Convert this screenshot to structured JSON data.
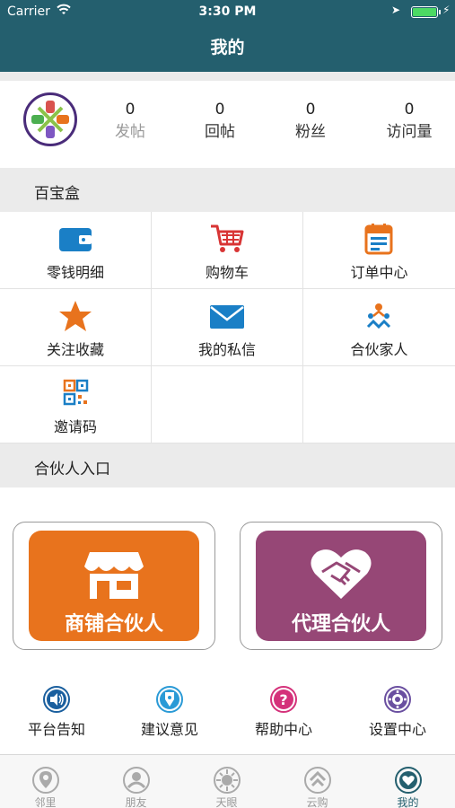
{
  "status_bar": {
    "carrier": "Carrier",
    "time": "3:30 PM"
  },
  "header": {
    "title": "我的"
  },
  "profile": {
    "stats": [
      {
        "value": "0",
        "label": "发帖"
      },
      {
        "value": "0",
        "label": "回帖"
      },
      {
        "value": "0",
        "label": "粉丝"
      },
      {
        "value": "0",
        "label": "访问量"
      }
    ]
  },
  "toolbox": {
    "title": "百宝盒",
    "items": [
      {
        "label": "零钱明细",
        "icon": "wallet-icon"
      },
      {
        "label": "购物车",
        "icon": "cart-icon"
      },
      {
        "label": "订单中心",
        "icon": "calendar-icon"
      },
      {
        "label": "关注收藏",
        "icon": "star-icon"
      },
      {
        "label": "我的私信",
        "icon": "mail-icon"
      },
      {
        "label": "合伙家人",
        "icon": "people-icon"
      },
      {
        "label": "邀请码",
        "icon": "qrcode-icon"
      }
    ]
  },
  "partner": {
    "title": "合伙人入口",
    "shop": {
      "label": "商铺合伙人",
      "color": "#e8731d"
    },
    "agent": {
      "label": "代理合伙人",
      "color": "#964776"
    }
  },
  "utilities": [
    {
      "label": "平台告知",
      "icon": "speaker-icon"
    },
    {
      "label": "建议意见",
      "icon": "pen-icon"
    },
    {
      "label": "帮助中心",
      "icon": "help-icon"
    },
    {
      "label": "设置中心",
      "icon": "settings-icon"
    }
  ],
  "tabbar": {
    "tabs": [
      {
        "label": "邻里",
        "icon": "location-icon"
      },
      {
        "label": "朋友",
        "icon": "friends-icon"
      },
      {
        "label": "天眼",
        "icon": "eye-icon"
      },
      {
        "label": "云购",
        "icon": "cloud-buy-icon"
      },
      {
        "label": "我的",
        "icon": "me-icon"
      }
    ],
    "active": "我的"
  },
  "colors": {
    "header": "#245f6e",
    "accent_orange": "#e8731d",
    "accent_purple": "#964776",
    "icon_blue": "#1a7fc6",
    "icon_red": "#d83535",
    "tab_active": "#245f6e"
  }
}
